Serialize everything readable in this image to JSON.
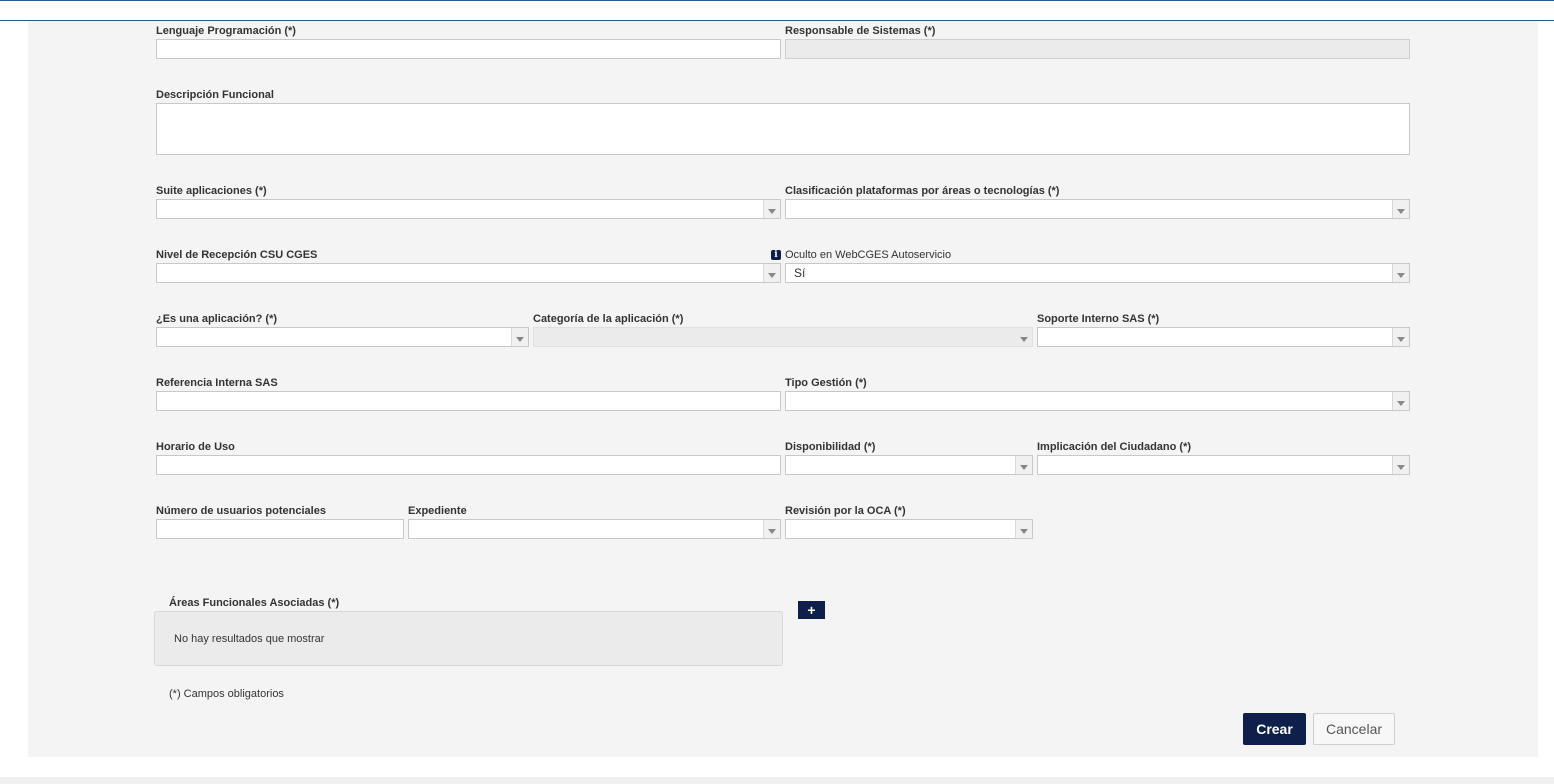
{
  "fields": {
    "lenguaje": {
      "label": "Lenguaje Programación (*)",
      "value": ""
    },
    "responsable": {
      "label": "Responsable de Sistemas (*)",
      "value": ""
    },
    "descripcion": {
      "label": "Descripción Funcional",
      "value": ""
    },
    "suite": {
      "label": "Suite aplicaciones (*)",
      "value": ""
    },
    "clasificacion": {
      "label": "Clasificación plataformas por áreas o tecnologías (*)",
      "value": ""
    },
    "nivel": {
      "label": "Nivel de Recepción CSU CGES",
      "value": ""
    },
    "oculto": {
      "label": "Oculto en WebCGES Autoservicio",
      "value": "Sí"
    },
    "es_aplicacion": {
      "label": "¿Es una aplicación? (*)",
      "value": ""
    },
    "categoria": {
      "label": "Categoría de la aplicación (*)",
      "value": ""
    },
    "soporte": {
      "label": "Soporte Interno SAS (*)",
      "value": ""
    },
    "referencia": {
      "label": "Referencia Interna SAS",
      "value": ""
    },
    "tipo_gestion": {
      "label": "Tipo Gestión (*)",
      "value": ""
    },
    "horario": {
      "label": "Horario de Uso",
      "value": ""
    },
    "disponibilidad": {
      "label": "Disponibilidad (*)",
      "value": ""
    },
    "implicacion": {
      "label": "Implicación del Ciudadano (*)",
      "value": ""
    },
    "num_usuarios": {
      "label": "Número de usuarios potenciales",
      "value": ""
    },
    "expediente": {
      "label": "Expediente",
      "value": ""
    },
    "revision": {
      "label": "Revisión por la OCA (*)",
      "value": ""
    }
  },
  "areas": {
    "label": "Áreas Funcionales Asociadas (*)",
    "add_label": "+",
    "empty_message": "No hay resultados que mostrar"
  },
  "info_icon": {
    "icon": "info-icon",
    "glyph": "i"
  },
  "note": "(*) Campos obligatorios",
  "buttons": {
    "crear": "Crear",
    "cancelar": "Cancelar"
  },
  "colors": {
    "primary": "#0f1f4b",
    "panel": "#f4f4f4",
    "rule": "#2a5d8f"
  }
}
